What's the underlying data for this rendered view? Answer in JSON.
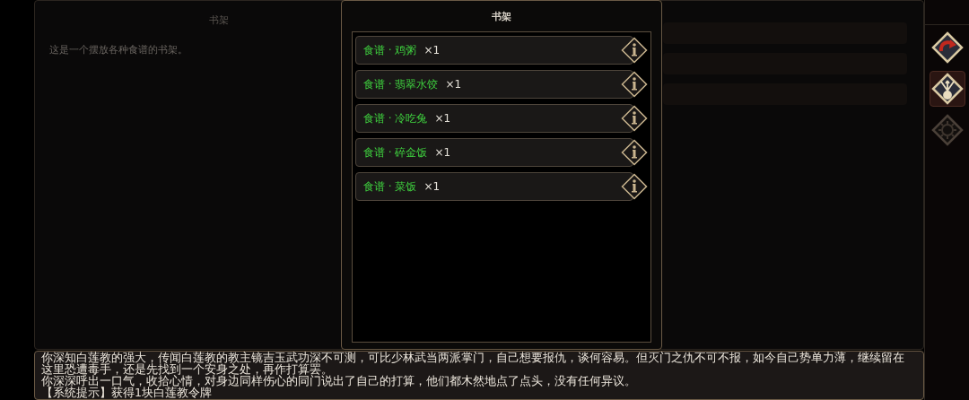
{
  "left_panel": {
    "title": "书架",
    "description": "这是一个摆放各种食谱的书架。",
    "rows": [
      {
        "kind": "empty"
      },
      {
        "kind": "empty"
      },
      {
        "kind": "empty"
      }
    ]
  },
  "popup": {
    "title": "书架",
    "items": [
      {
        "name": "食谱 · 鸡粥",
        "count": "×1"
      },
      {
        "name": "食谱 · 翡翠水饺",
        "count": "×1"
      },
      {
        "name": "食谱 · 冷吃兔",
        "count": "×1"
      },
      {
        "name": "食谱 · 碎金饭",
        "count": "×1"
      },
      {
        "name": "食谱 · 菜饭",
        "count": "×1"
      }
    ]
  },
  "sidebar": [
    {
      "kind": "redo",
      "selected": false,
      "disabled": false
    },
    {
      "kind": "fork",
      "selected": true,
      "disabled": false
    },
    {
      "kind": "gear",
      "selected": false,
      "disabled": true
    }
  ],
  "log": {
    "lines": [
      "你深知白莲教的强大，传闻白莲教的教主镜吉玉武功深不可测，可比少林武当两派掌门，自己想要报仇，谈何容易。但灭门之仇不可不报，如今自己势单力薄，继续留在这里恐遭毒手，还是先找到一个安身之处，再作打算罢。",
      "你深深呼出一口气，收拾心情，对身边同样伤心的同门说出了自己的打算，他们都木然地点了点头，没有任何异议。",
      "【系统提示】获得1块白莲教令牌"
    ]
  }
}
